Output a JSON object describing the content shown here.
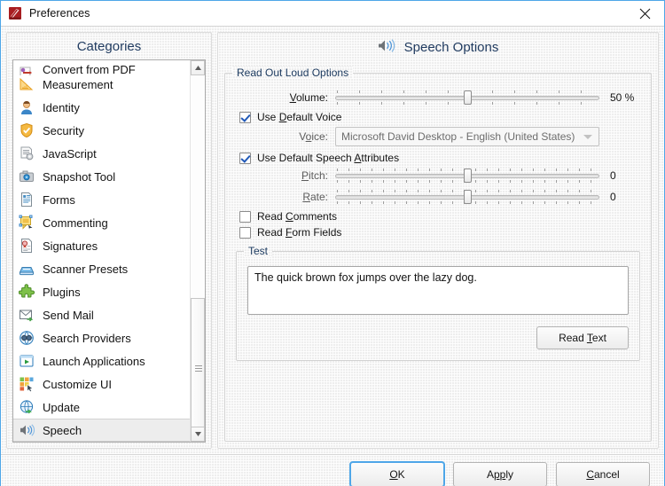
{
  "window": {
    "title": "Preferences",
    "app_icon": "pdf-xchange-icon",
    "close_icon": "close-icon",
    "border_color": "#4ea6e8"
  },
  "categories": {
    "header": "Categories",
    "items": [
      {
        "label": "Convert from PDF",
        "icon": "convert-from-pdf-icon",
        "selected": false,
        "clipped": true
      },
      {
        "label": "Measurement",
        "icon": "measurement-icon",
        "selected": false
      },
      {
        "label": "Identity",
        "icon": "identity-icon",
        "selected": false
      },
      {
        "label": "Security",
        "icon": "security-icon",
        "selected": false
      },
      {
        "label": "JavaScript",
        "icon": "javascript-icon",
        "selected": false
      },
      {
        "label": "Snapshot Tool",
        "icon": "snapshot-tool-icon",
        "selected": false
      },
      {
        "label": "Forms",
        "icon": "forms-icon",
        "selected": false
      },
      {
        "label": "Commenting",
        "icon": "commenting-icon",
        "selected": false
      },
      {
        "label": "Signatures",
        "icon": "signatures-icon",
        "selected": false
      },
      {
        "label": "Scanner Presets",
        "icon": "scanner-presets-icon",
        "selected": false
      },
      {
        "label": "Plugins",
        "icon": "plugins-icon",
        "selected": false
      },
      {
        "label": "Send Mail",
        "icon": "send-mail-icon",
        "selected": false
      },
      {
        "label": "Search Providers",
        "icon": "search-providers-icon",
        "selected": false
      },
      {
        "label": "Launch Applications",
        "icon": "launch-applications-icon",
        "selected": false
      },
      {
        "label": "Customize UI",
        "icon": "customize-ui-icon",
        "selected": false
      },
      {
        "label": "Update",
        "icon": "update-icon",
        "selected": false
      },
      {
        "label": "Speech",
        "icon": "speech-icon",
        "selected": true
      }
    ],
    "scrollbar": {
      "up_icon": "scroll-up-arrow-icon",
      "down_icon": "scroll-down-arrow-icon"
    }
  },
  "options": {
    "header": "Speech Options",
    "header_icon": "speaker-icon",
    "read_out_loud": {
      "group_label": "Read Out Loud Options",
      "volume": {
        "label": "Volume:",
        "mnemonic": "V",
        "value": 50,
        "display": "50 %",
        "percent": 50
      },
      "use_default_voice": {
        "label": "Use Default Voice",
        "mnemonic": "D",
        "checked": true
      },
      "voice": {
        "label": "Voice:",
        "mnemonic": "o",
        "value": "Microsoft David Desktop - English (United States)",
        "arrow_icon": "chevron-down-icon",
        "disabled": true
      },
      "use_default_speech_attributes": {
        "label": "Use Default Speech Attributes",
        "mnemonic": "A",
        "checked": true
      },
      "pitch": {
        "label": "Pitch:",
        "mnemonic": "P",
        "value": 0,
        "display": "0",
        "percent": 50
      },
      "rate": {
        "label": "Rate:",
        "mnemonic": "R",
        "value": 0,
        "display": "0",
        "percent": 50
      },
      "read_comments": {
        "label": "Read Comments",
        "mnemonic": "C",
        "checked": false
      },
      "read_form_fields": {
        "label": "Read Form Fields",
        "mnemonic": "F",
        "checked": false
      }
    },
    "test": {
      "group_label": "Test",
      "text": "The quick brown fox jumps over the lazy dog.",
      "read_text_button": "Read Text"
    }
  },
  "footer": {
    "ok": "OK",
    "apply": "Apply",
    "cancel": "Cancel",
    "focus_accent": "#4ea6e8"
  }
}
